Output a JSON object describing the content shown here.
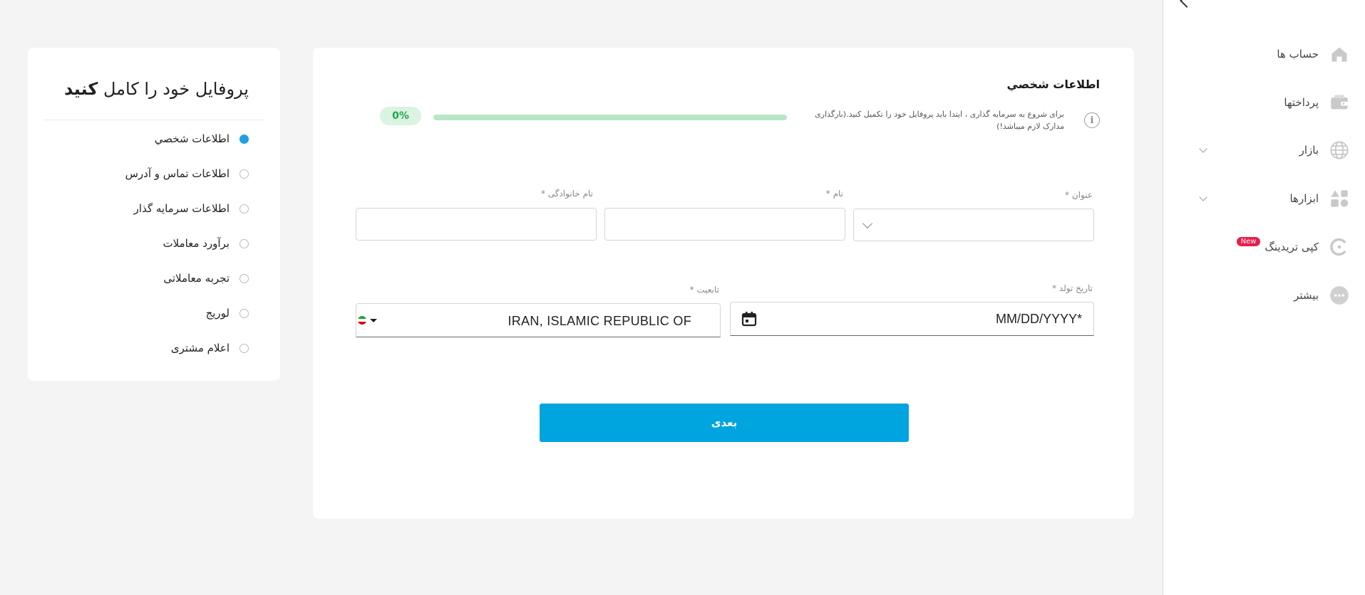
{
  "sidebar": {
    "items": [
      {
        "label": "حساب ها",
        "icon": "home-icon"
      },
      {
        "label": "پرداختها",
        "icon": "wallet-icon"
      },
      {
        "label": "بازار",
        "icon": "globe-icon",
        "has_dropdown": true
      },
      {
        "label": "ابزارها",
        "icon": "tools-icon",
        "has_dropdown": true
      },
      {
        "label": "کپی تریدینگ",
        "icon": "copy-trading-icon",
        "badge": "New"
      },
      {
        "label": "بیشتر",
        "icon": "more-icon"
      }
    ]
  },
  "form": {
    "section_title": "اطلاعات شخصي",
    "notice": "برای شروع به سرمایه گذاری ، ابتدا باید پروفایل خود را تکمیل کنید.(بارگذاری مدارک لازم میباشد!)",
    "progress": {
      "label": "0%",
      "value": 0
    },
    "fields": {
      "title_label": "عنوان *",
      "first_name_label": "نام *",
      "last_name_label": "نام خانوادگی *",
      "birth_date_label": "تاریخ تولد *",
      "birth_date_placeholder": "MM/DD/YYYY*",
      "nationality_label": "تابعیت *",
      "nationality_value": "IRAN, ISLAMIC REPUBLIC OF"
    },
    "next_button": "بعدی"
  },
  "steps": {
    "title_prefix": "پروفایل خود را کامل",
    "title_bold": "کنید",
    "items": [
      {
        "label": "اطلاعات شخصي",
        "active": true
      },
      {
        "label": "اطلاعات تماس و آدرس",
        "active": false
      },
      {
        "label": "اطلاعات سرمایه گذار",
        "active": false
      },
      {
        "label": "برآورد معاملات",
        "active": false
      },
      {
        "label": "تجربه معاملاتی",
        "active": false
      },
      {
        "label": "لوریج",
        "active": false
      },
      {
        "label": "اعلام مشتری",
        "active": false
      }
    ]
  },
  "colors": {
    "accent": "#00a5df",
    "progress_green": "#2ebd5b",
    "badge_red": "#e81e4b"
  }
}
